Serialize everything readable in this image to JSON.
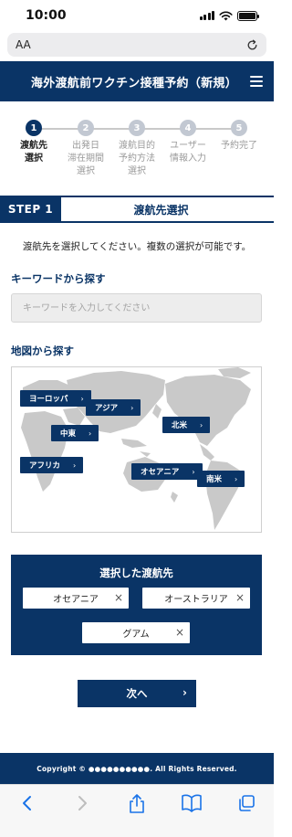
{
  "status_bar": {
    "time": "10:00",
    "battery_level": 1.0
  },
  "browser": {
    "text_size_label": "AA",
    "toolbar_icons": [
      "back-icon",
      "forward-icon",
      "share-icon",
      "bookmarks-icon",
      "tabs-icon"
    ]
  },
  "header": {
    "title": "海外渡航前ワクチン接種予約（新規）"
  },
  "steps": [
    {
      "number": "1",
      "label": "渡航先\n選択",
      "active": true
    },
    {
      "number": "2",
      "label": "出発日\n滞在期間\n選択",
      "active": false
    },
    {
      "number": "3",
      "label": "渡航目的\n予約方法\n選択",
      "active": false
    },
    {
      "number": "4",
      "label": "ユーザー\n情報入力",
      "active": false
    },
    {
      "number": "5",
      "label": "予約完了",
      "active": false
    }
  ],
  "step_banner": {
    "badge": "STEP 1",
    "heading": "渡航先選択"
  },
  "instruction": "渡航先を選択してください。複数の選択が可能です。",
  "keyword_search": {
    "title": "キーワードから探す",
    "placeholder": "キーワードを入力してください",
    "value": ""
  },
  "map_search": {
    "title": "地図から探す",
    "regions": [
      {
        "id": "europe",
        "label": "ヨーロッパ",
        "arrow": "›"
      },
      {
        "id": "asia",
        "label": "アジア",
        "arrow": "›"
      },
      {
        "id": "middle-east",
        "label": "中東",
        "arrow": "›"
      },
      {
        "id": "north-america",
        "label": "北米",
        "arrow": "›"
      },
      {
        "id": "africa",
        "label": "アフリカ",
        "arrow": "›"
      },
      {
        "id": "oceania",
        "label": "オセアニア",
        "arrow": "›"
      },
      {
        "id": "south-america",
        "label": "南米",
        "arrow": "›"
      }
    ]
  },
  "selected": {
    "title": "選択した渡航先",
    "items": [
      {
        "label": "オセアニア",
        "remove": "×"
      },
      {
        "label": "オーストラリア",
        "remove": "×"
      },
      {
        "label": "グアム",
        "remove": "×"
      }
    ]
  },
  "next_button": {
    "label": "次へ",
    "arrow": "›"
  },
  "footer": {
    "copyright": "Copyright © ●●●●●●●●●●. All Rights Reserved."
  },
  "colors": {
    "primary": "#0a3466",
    "map_land": "#c9c9c9",
    "step_inactive": "#c2c8d2"
  }
}
